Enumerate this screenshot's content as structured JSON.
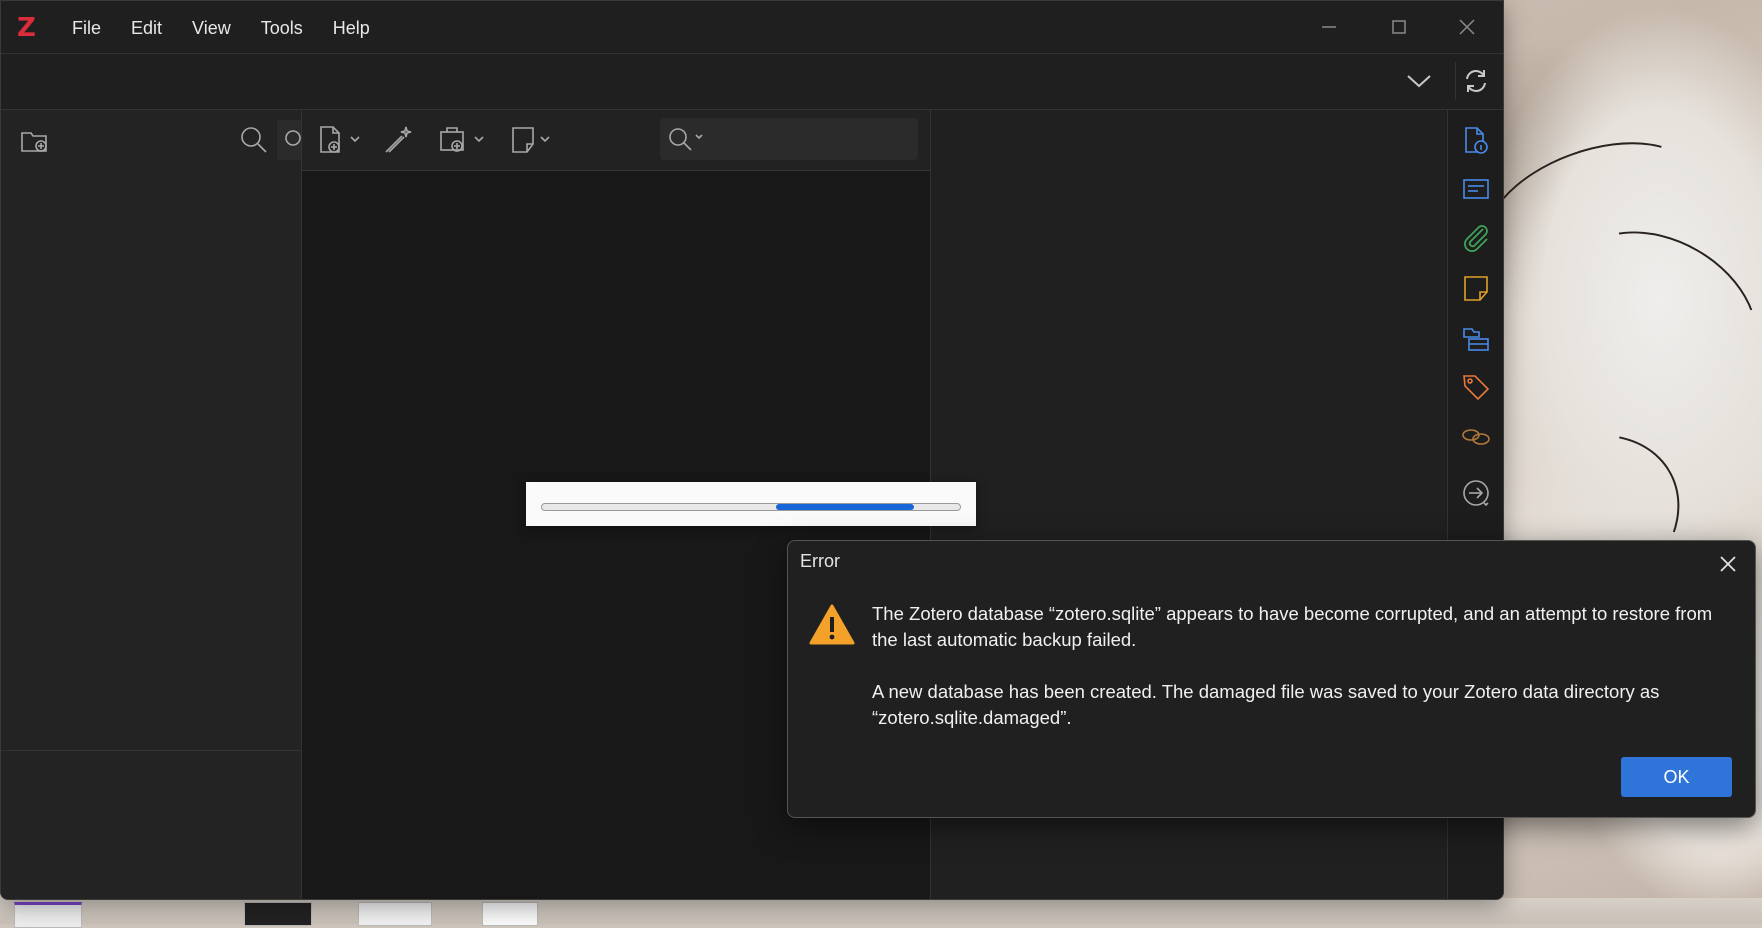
{
  "app": {
    "logo": "Z"
  },
  "menu": [
    "File",
    "Edit",
    "View",
    "Tools",
    "Help"
  ],
  "progress": {
    "start_fraction": 0.56,
    "end_fraction": 0.89
  },
  "dialog": {
    "title": "Error",
    "message_line1": "The Zotero database “zotero.sqlite” appears to have become corrupted, and an attempt to restore from the last automatic backup failed.",
    "message_line2": "A new database has been created. The damaged file was saved to your Zotero data directory as “zotero.sqlite.damaged”.",
    "ok_label": "OK"
  },
  "colors": {
    "accent": "#2f74d8",
    "logo": "#db2c3a",
    "warning": "#f4a12a",
    "progress": "#1966d8"
  },
  "icons": {
    "toolbar_left": [
      "new-collection-icon",
      "search-icon"
    ],
    "toolbar_mid": [
      "new-item-icon",
      "magic-wand-icon",
      "add-attachment-icon",
      "new-note-icon"
    ],
    "sidenav": [
      "info-icon",
      "abstract-icon",
      "attachments-icon",
      "notes-icon",
      "libraries-icon",
      "tags-icon",
      "related-icon",
      "locate-icon"
    ]
  }
}
